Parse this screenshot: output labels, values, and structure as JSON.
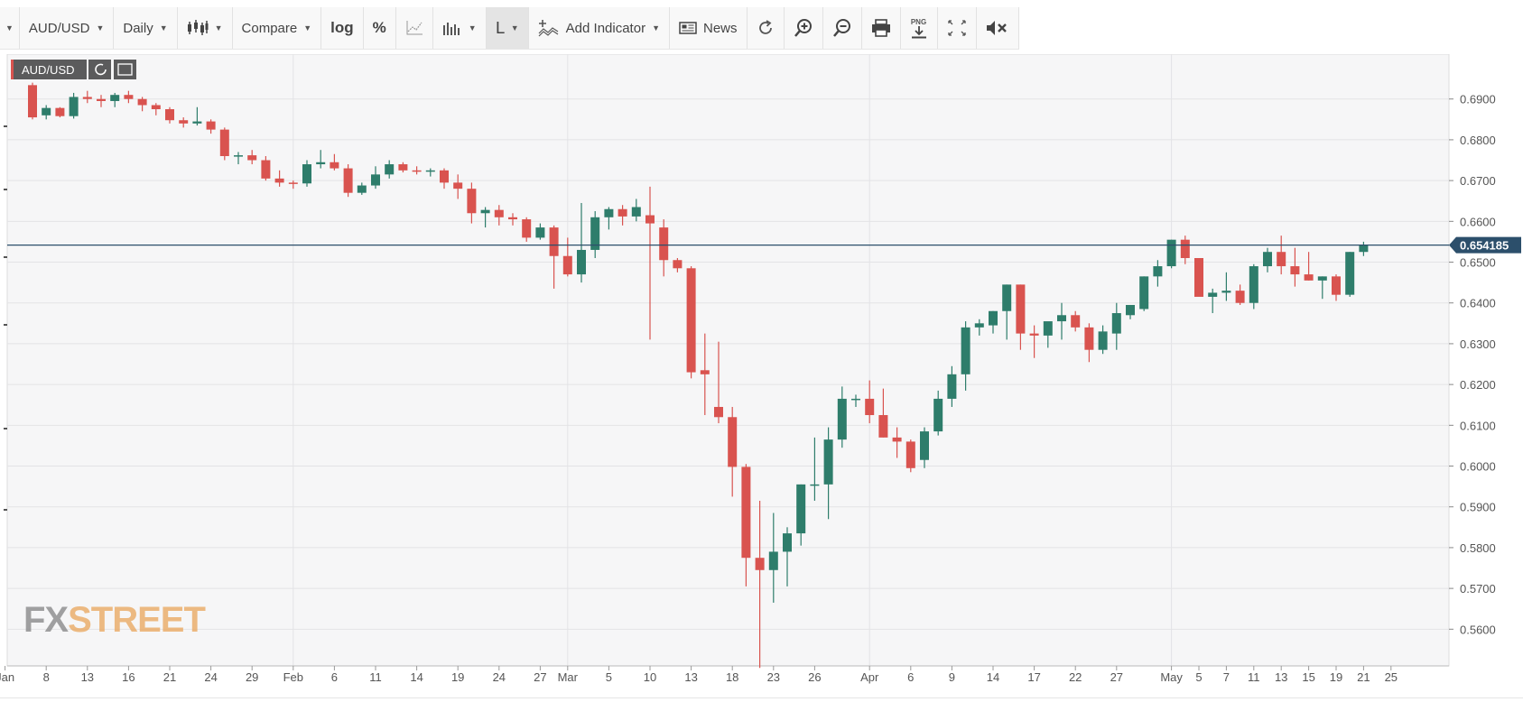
{
  "toolbar": {
    "menu_icon": "caret-down-icon",
    "symbol": "AUD/USD",
    "interval": "Daily",
    "chart_type_icon": "candlestick-icon",
    "compare": "Compare",
    "log": "log",
    "percent": "%",
    "draw_icon": "line-chart-icon",
    "volume_icon": "bars-icon",
    "drawing_tool": "L",
    "add_indicator": "Add Indicator",
    "news": "News",
    "refresh_icon": "refresh-icon",
    "zoom_in_icon": "zoom-in-icon",
    "zoom_out_icon": "zoom-out-icon",
    "print_icon": "print-icon",
    "png_label": "PNG",
    "fullscreen_icon": "fullscreen-icon",
    "mute_icon": "mute-icon"
  },
  "legend": {
    "symbol": "AUD/USD"
  },
  "watermark": {
    "part1": "FX",
    "part2": "STREET"
  },
  "colors": {
    "up": "#2e7d6b",
    "down": "#d9534f",
    "price_line": "#2c4f6b",
    "price_badge": "#2c4f6b",
    "fx": "#8a8a8a",
    "street": "#e8a04f"
  },
  "chart_data": {
    "type": "candlestick",
    "ylim": [
      0.551,
      0.701
    ],
    "y_ticks": [
      0.69,
      0.68,
      0.67,
      0.66,
      0.65,
      0.64,
      0.63,
      0.62,
      0.61,
      0.6,
      0.59,
      0.58,
      0.57,
      0.56
    ],
    "x_ticks": [
      {
        "label": "Jan",
        "i": -2
      },
      {
        "label": "8",
        "i": 1
      },
      {
        "label": "13",
        "i": 4
      },
      {
        "label": "16",
        "i": 7
      },
      {
        "label": "21",
        "i": 10
      },
      {
        "label": "24",
        "i": 13
      },
      {
        "label": "29",
        "i": 16
      },
      {
        "label": "Feb",
        "i": 19
      },
      {
        "label": "6",
        "i": 22
      },
      {
        "label": "11",
        "i": 25
      },
      {
        "label": "14",
        "i": 28
      },
      {
        "label": "19",
        "i": 31
      },
      {
        "label": "24",
        "i": 34
      },
      {
        "label": "27",
        "i": 37
      },
      {
        "label": "Mar",
        "i": 39
      },
      {
        "label": "5",
        "i": 42
      },
      {
        "label": "10",
        "i": 45
      },
      {
        "label": "13",
        "i": 48
      },
      {
        "label": "18",
        "i": 51
      },
      {
        "label": "23",
        "i": 54
      },
      {
        "label": "26",
        "i": 57
      },
      {
        "label": "Apr",
        "i": 61
      },
      {
        "label": "6",
        "i": 64
      },
      {
        "label": "9",
        "i": 67
      },
      {
        "label": "14",
        "i": 70
      },
      {
        "label": "17",
        "i": 73
      },
      {
        "label": "22",
        "i": 76
      },
      {
        "label": "27",
        "i": 79
      },
      {
        "label": "May",
        "i": 83
      },
      {
        "label": "5",
        "i": 85
      },
      {
        "label": "7",
        "i": 87
      },
      {
        "label": "11",
        "i": 89
      },
      {
        "label": "13",
        "i": 91
      },
      {
        "label": "15",
        "i": 93
      },
      {
        "label": "19",
        "i": 95
      },
      {
        "label": "21",
        "i": 97
      },
      {
        "label": "25",
        "i": 99
      }
    ],
    "vgrid_i": [
      19,
      39,
      61,
      83
    ],
    "last_price": "0.654185",
    "last_value": 0.654185,
    "ohlc": [
      [
        0.6934,
        0.694,
        0.685,
        0.6855
      ],
      [
        0.686,
        0.6885,
        0.685,
        0.6878
      ],
      [
        0.6878,
        0.688,
        0.6855,
        0.6858
      ],
      [
        0.6858,
        0.6915,
        0.6852,
        0.6905
      ],
      [
        0.6905,
        0.692,
        0.689,
        0.69
      ],
      [
        0.69,
        0.691,
        0.688,
        0.6895
      ],
      [
        0.6895,
        0.6915,
        0.688,
        0.691
      ],
      [
        0.691,
        0.692,
        0.689,
        0.69
      ],
      [
        0.69,
        0.6905,
        0.687,
        0.6885
      ],
      [
        0.6885,
        0.689,
        0.686,
        0.6875
      ],
      [
        0.6875,
        0.688,
        0.684,
        0.6848
      ],
      [
        0.6848,
        0.6855,
        0.683,
        0.684
      ],
      [
        0.684,
        0.688,
        0.6835,
        0.6845
      ],
      [
        0.6845,
        0.685,
        0.6815,
        0.6825
      ],
      [
        0.6825,
        0.683,
        0.675,
        0.676
      ],
      [
        0.676,
        0.677,
        0.674,
        0.6762
      ],
      [
        0.6762,
        0.6775,
        0.674,
        0.675
      ],
      [
        0.675,
        0.676,
        0.67,
        0.6705
      ],
      [
        0.6705,
        0.6725,
        0.6685,
        0.6695
      ],
      [
        0.6695,
        0.67,
        0.668,
        0.6693
      ],
      [
        0.6693,
        0.675,
        0.6685,
        0.674
      ],
      [
        0.674,
        0.6775,
        0.673,
        0.6745
      ],
      [
        0.6745,
        0.6765,
        0.6725,
        0.673
      ],
      [
        0.673,
        0.674,
        0.666,
        0.667
      ],
      [
        0.667,
        0.6695,
        0.6665,
        0.6688
      ],
      [
        0.6688,
        0.6735,
        0.668,
        0.6715
      ],
      [
        0.6715,
        0.675,
        0.6705,
        0.674
      ],
      [
        0.674,
        0.6745,
        0.672,
        0.6725
      ],
      [
        0.6725,
        0.6735,
        0.6715,
        0.6722
      ],
      [
        0.6722,
        0.673,
        0.671,
        0.6725
      ],
      [
        0.6725,
        0.673,
        0.668,
        0.6695
      ],
      [
        0.6695,
        0.6715,
        0.6655,
        0.668
      ],
      [
        0.668,
        0.6695,
        0.6595,
        0.662
      ],
      [
        0.662,
        0.6635,
        0.6585,
        0.6628
      ],
      [
        0.6628,
        0.664,
        0.659,
        0.661
      ],
      [
        0.661,
        0.662,
        0.659,
        0.6605
      ],
      [
        0.6605,
        0.661,
        0.655,
        0.656
      ],
      [
        0.656,
        0.6595,
        0.6555,
        0.6585
      ],
      [
        0.6585,
        0.659,
        0.6435,
        0.6515
      ],
      [
        0.6515,
        0.656,
        0.6465,
        0.647
      ],
      [
        0.647,
        0.6645,
        0.645,
        0.653
      ],
      [
        0.653,
        0.6625,
        0.651,
        0.661
      ],
      [
        0.661,
        0.6635,
        0.658,
        0.663
      ],
      [
        0.663,
        0.664,
        0.659,
        0.6612
      ],
      [
        0.6612,
        0.6655,
        0.66,
        0.6635
      ],
      [
        0.6615,
        0.6685,
        0.631,
        0.6595
      ],
      [
        0.6585,
        0.6605,
        0.6465,
        0.6505
      ],
      [
        0.6505,
        0.651,
        0.6475,
        0.6485
      ],
      [
        0.6485,
        0.649,
        0.6215,
        0.623
      ],
      [
        0.6235,
        0.6325,
        0.6125,
        0.6225
      ],
      [
        0.6145,
        0.6305,
        0.6105,
        0.612
      ],
      [
        0.612,
        0.6145,
        0.5925,
        0.5998
      ],
      [
        0.5998,
        0.6005,
        0.5705,
        0.5775
      ],
      [
        0.5775,
        0.5915,
        0.5505,
        0.5745
      ],
      [
        0.5745,
        0.5885,
        0.5665,
        0.579
      ],
      [
        0.579,
        0.585,
        0.5705,
        0.5835
      ],
      [
        0.5835,
        0.5955,
        0.5805,
        0.5955
      ],
      [
        0.5955,
        0.607,
        0.5915,
        0.5955
      ],
      [
        0.5955,
        0.6095,
        0.587,
        0.6065
      ],
      [
        0.6065,
        0.6195,
        0.6045,
        0.6165
      ],
      [
        0.6165,
        0.6175,
        0.6145,
        0.6165
      ],
      [
        0.6165,
        0.621,
        0.6105,
        0.6125
      ],
      [
        0.6125,
        0.619,
        0.607,
        0.607
      ],
      [
        0.607,
        0.6095,
        0.602,
        0.606
      ],
      [
        0.606,
        0.6065,
        0.5985,
        0.5995
      ],
      [
        0.6015,
        0.6095,
        0.5995,
        0.6085
      ],
      [
        0.6085,
        0.6185,
        0.6075,
        0.6165
      ],
      [
        0.6165,
        0.6245,
        0.6145,
        0.6225
      ],
      [
        0.6225,
        0.6355,
        0.6185,
        0.634
      ],
      [
        0.634,
        0.636,
        0.632,
        0.635
      ],
      [
        0.6345,
        0.638,
        0.6325,
        0.638
      ],
      [
        0.638,
        0.6445,
        0.631,
        0.6445
      ],
      [
        0.6445,
        0.6445,
        0.6285,
        0.6325
      ],
      [
        0.6325,
        0.6345,
        0.6265,
        0.632
      ],
      [
        0.632,
        0.635,
        0.629,
        0.6355
      ],
      [
        0.6355,
        0.64,
        0.631,
        0.637
      ],
      [
        0.637,
        0.638,
        0.633,
        0.634
      ],
      [
        0.634,
        0.635,
        0.6255,
        0.6285
      ],
      [
        0.6285,
        0.6345,
        0.6275,
        0.633
      ],
      [
        0.6325,
        0.64,
        0.6285,
        0.6375
      ],
      [
        0.637,
        0.6395,
        0.636,
        0.6395
      ],
      [
        0.6385,
        0.6465,
        0.638,
        0.6465
      ],
      [
        0.6465,
        0.6505,
        0.644,
        0.649
      ],
      [
        0.649,
        0.6555,
        0.6485,
        0.6555
      ],
      [
        0.6555,
        0.6565,
        0.6495,
        0.651
      ],
      [
        0.651,
        0.651,
        0.642,
        0.6415
      ],
      [
        0.6415,
        0.6435,
        0.6375,
        0.6425
      ],
      [
        0.6425,
        0.6475,
        0.6405,
        0.643
      ],
      [
        0.643,
        0.6445,
        0.6395,
        0.64
      ],
      [
        0.64,
        0.6495,
        0.6385,
        0.649
      ],
      [
        0.649,
        0.6535,
        0.6475,
        0.6525
      ],
      [
        0.6525,
        0.6565,
        0.647,
        0.649
      ],
      [
        0.649,
        0.6535,
        0.644,
        0.647
      ],
      [
        0.647,
        0.6525,
        0.6455,
        0.6455
      ],
      [
        0.6455,
        0.6465,
        0.641,
        0.6465
      ],
      [
        0.6465,
        0.647,
        0.6405,
        0.642
      ],
      [
        0.642,
        0.6525,
        0.6415,
        0.6525
      ],
      [
        0.6525,
        0.655,
        0.6515,
        0.6542
      ]
    ]
  }
}
